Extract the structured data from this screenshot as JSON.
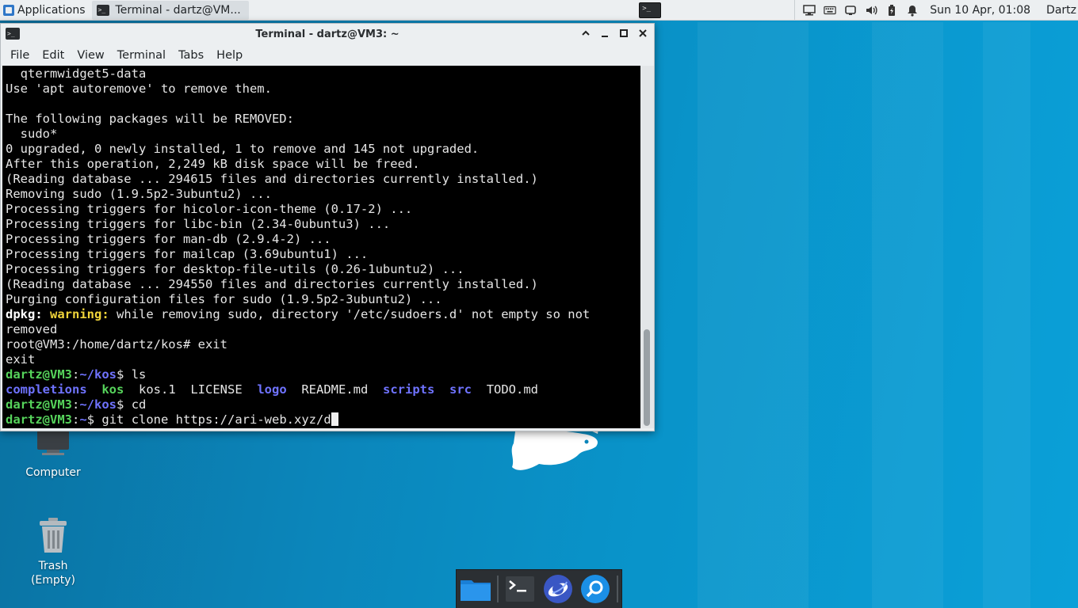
{
  "top_panel": {
    "applications_label": "Applications",
    "task_title": "Terminal - dartz@VM...",
    "clock": "Sun 10 Apr, 01:08",
    "user": "Dartz"
  },
  "window": {
    "title": "Terminal - dartz@VM3: ~",
    "menu": [
      "File",
      "Edit",
      "View",
      "Terminal",
      "Tabs",
      "Help"
    ]
  },
  "terminal": {
    "plain_lines": [
      "  qtermwidget5-data",
      "Use 'apt autoremove' to remove them.",
      "",
      "The following packages will be REMOVED:",
      "  sudo*",
      "0 upgraded, 0 newly installed, 1 to remove and 145 not upgraded.",
      "After this operation, 2,249 kB disk space will be freed.",
      "(Reading database ... 294615 files and directories currently installed.)",
      "Removing sudo (1.9.5p2-3ubuntu2) ...",
      "Processing triggers for hicolor-icon-theme (0.17-2) ...",
      "Processing triggers for libc-bin (2.34-0ubuntu3) ...",
      "Processing triggers for man-db (2.9.4-2) ...",
      "Processing triggers for mailcap (3.69ubuntu1) ...",
      "Processing triggers for desktop-file-utils (0.26-1ubuntu2) ...",
      "(Reading database ... 294550 files and directories currently installed.)",
      "Purging configuration files for sudo (1.9.5p2-3ubuntu2) ..."
    ],
    "dpkg_prefix": "dpkg:",
    "warning_word": "warning:",
    "warning_text": " while removing sudo, directory '/etc/sudoers.d' not empty so not",
    "warning_cont": "removed",
    "root_prompt_line": "root@VM3:/home/dartz/kos# exit",
    "exit_line": "exit",
    "prompt_user": "dartz@VM3",
    "prompt_colon": ":",
    "prompt_path_kos": "~/kos",
    "prompt_path_home": "~",
    "prompt_symbol": "$",
    "cmd_ls": " ls",
    "cmd_cd": " cd",
    "cmd_git": " git clone https://ari-web.xyz/d",
    "ls_output": [
      {
        "name": "completions",
        "type": "dir"
      },
      {
        "name": "kos",
        "type": "exec"
      },
      {
        "name": "kos.1",
        "type": "file"
      },
      {
        "name": "LICENSE",
        "type": "file"
      },
      {
        "name": "logo",
        "type": "dir"
      },
      {
        "name": "README.md",
        "type": "file"
      },
      {
        "name": "scripts",
        "type": "dir"
      },
      {
        "name": "src",
        "type": "dir"
      },
      {
        "name": "TODO.md",
        "type": "file"
      }
    ]
  },
  "desktop": {
    "computer_label": "Computer",
    "trash_label": "Trash",
    "trash_sub": "(Empty)"
  },
  "dock_items": [
    "files-icon",
    "terminal-icon",
    "browser-icon",
    "search-icon"
  ],
  "colors": {
    "prompt_green": "#56d35b",
    "dir_blue": "#6f73ff",
    "warning_yellow": "#f0d43a",
    "desktop_blue": "#0993c9"
  }
}
